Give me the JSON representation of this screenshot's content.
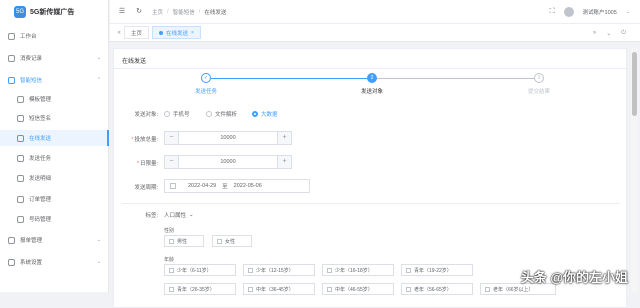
{
  "app": {
    "logo_mark": "5G",
    "title": "5G新传媒广告"
  },
  "sidebar": {
    "items": [
      {
        "label": "工作台",
        "icon": "desktop-icon"
      },
      {
        "label": "消费记录",
        "icon": "coin-icon",
        "arrow": "⌄"
      },
      {
        "label": "智能短信",
        "icon": "message-icon",
        "arrow": "⌃"
      },
      {
        "label": "模板管理",
        "icon": "template-icon"
      },
      {
        "label": "短信签名",
        "icon": "signature-icon"
      },
      {
        "label": "在线发送",
        "icon": "send-icon"
      },
      {
        "label": "发送任务",
        "icon": "task-icon"
      },
      {
        "label": "发送明细",
        "icon": "detail-icon"
      },
      {
        "label": "订单管理",
        "icon": "order-icon"
      },
      {
        "label": "号码管理",
        "icon": "number-icon"
      },
      {
        "label": "报单管理",
        "icon": "report-icon",
        "arrow": "⌄"
      },
      {
        "label": "系统设置",
        "icon": "settings-icon",
        "arrow": "⌄"
      }
    ]
  },
  "topbar": {
    "breadcrumb": [
      "主页",
      "智能短信",
      "在线发送"
    ],
    "user": "测试账户1005",
    "user_arrow": "⌄"
  },
  "tabs": {
    "items": [
      {
        "label": "主页"
      },
      {
        "label": "在线发送",
        "close": "×"
      }
    ]
  },
  "page": {
    "card_title": "在线发送",
    "steps": [
      {
        "label": "发送任务",
        "mark": "✓"
      },
      {
        "label": "发送对象",
        "mark": "2"
      },
      {
        "label": "提交结果",
        "mark": "3"
      }
    ],
    "form": {
      "send_type_label": "发送对象:",
      "send_type_options": [
        "手机号",
        "文件解析",
        "大数据"
      ],
      "send_type_selected": "大数据",
      "total_label": "投放总量:",
      "total_value": "10000",
      "daily_label": "日限量:",
      "daily_value": "10000",
      "period_label": "发送周期:",
      "date_start": "2022-04-29",
      "date_sep": "至",
      "date_end": "2022-05-06",
      "minus": "−",
      "plus": "+"
    },
    "tags": {
      "label": "标签:",
      "select_value": "人口属性",
      "select_arrow": "⌄",
      "gender_label": "性别",
      "gender_options": [
        "男性",
        "女性"
      ],
      "age_label": "年龄",
      "age_row1": [
        "少年（6-11岁）",
        "少年（12-15岁）",
        "少年（16-18岁）",
        "青年（19-22岁）"
      ],
      "age_row2": [
        "青年（26-35岁）",
        "中年（36-45岁）",
        "中年（46-55岁）",
        "老年（56-65岁）",
        "老年（66岁以上）"
      ]
    }
  },
  "watermark": "头条 @你的左小姐"
}
